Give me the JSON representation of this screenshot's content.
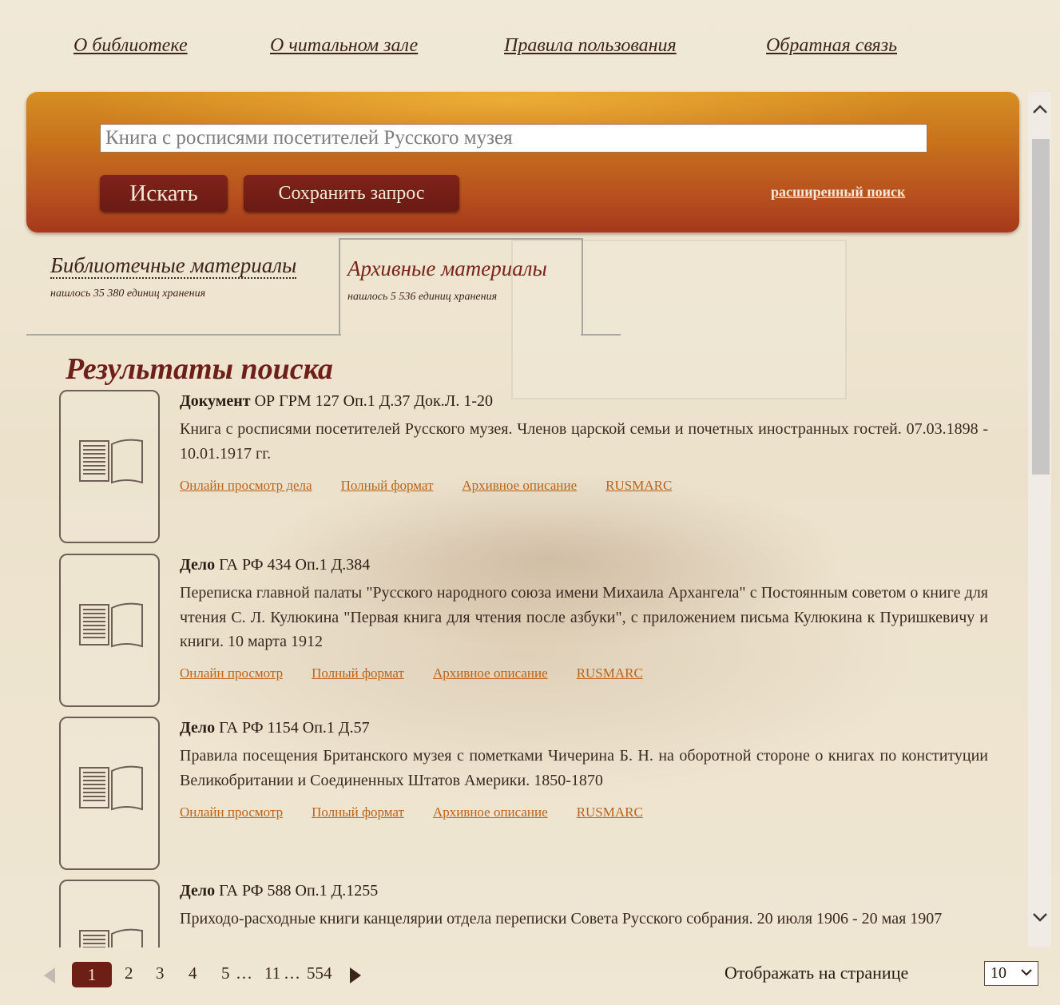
{
  "nav": {
    "about_library": "О библиотеке",
    "about_reading_room": "О читальном зале",
    "rules": "Правила пользования",
    "feedback": "Обратная связь"
  },
  "search": {
    "query": "Книга с росписями посетителей Русского музея",
    "search_button": "Искать",
    "save_button": "Сохранить запрос",
    "advanced_link": "расширенный поиск"
  },
  "tabs": [
    {
      "label": "Библиотечные материалы",
      "count": "нашлось 35 380 единиц хранения",
      "active": false
    },
    {
      "label": "Архивные материалы",
      "count": "нашлось 5 536 единиц хранения",
      "active": true
    }
  ],
  "results_title": "Результаты поиска",
  "results": [
    {
      "type": "Документ",
      "ref": " ОР ГРМ 127 Оп.1 Д.37 Док.Л. 1-20",
      "description": "Книга с росписями посетителей Русского музея. Членов царской семьи и почетных иностранных гостей. 07.03.1898 - 10.01.1917 гг.",
      "links": [
        "Онлайн просмотр дела",
        "Полный формат",
        "Архивное описание",
        "RUSMARC"
      ]
    },
    {
      "type": "Дело",
      "ref": " ГА РФ 434 Оп.1 Д.384",
      "description": "Переписка главной палаты \"Русского народного союза имени Михаила Архангела\" с Постоянным советом о книге для чтения С. Л. Кулюкина \"Первая книга для чтения после азбуки\", с приложением письма Кулюкина к Пуришкевичу и книги. 10 марта 1912",
      "links": [
        "Онлайн просмотр",
        "Полный формат",
        "Архивное описание",
        "RUSMARC"
      ]
    },
    {
      "type": "Дело",
      "ref": " ГА РФ 1154 Оп.1 Д.57",
      "description": "Правила посещения Британского музея с пометками Чичерина Б. Н. на оборотной стороне о книгах по конституции Великобритании и Соединенных Штатов Америки. 1850-1870",
      "links": [
        "Онлайн просмотр",
        "Полный формат",
        "Архивное описание",
        "RUSMARC"
      ]
    },
    {
      "type": "Дело",
      "ref": " ГА РФ 588 Оп.1 Д.1255",
      "description": "Приходо-расходные книги канцелярии отдела переписки Совета Русского собрания. 20 июля 1906 - 20 мая 1907",
      "links": []
    }
  ],
  "pagination": {
    "current": "1",
    "pages": [
      "2",
      "3",
      "4",
      "5",
      "…",
      "11",
      "…",
      "554"
    ]
  },
  "per_page": {
    "label": "Отображать на странице",
    "value": "10"
  },
  "icons": {
    "prev": "chevron-left-icon",
    "next": "chevron-right-icon",
    "document": "book-document-icon"
  }
}
